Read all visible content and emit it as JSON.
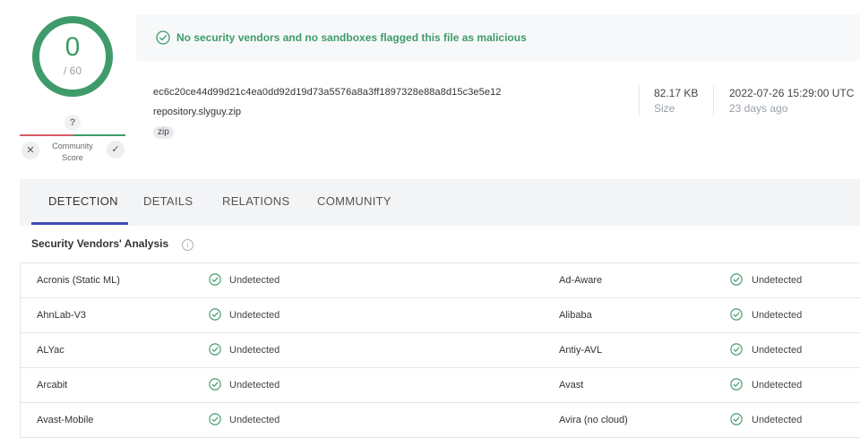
{
  "score": {
    "detected": "0",
    "total": "/ 60"
  },
  "community": {
    "question": "?",
    "label_line1": "Community",
    "label_line2": "Score"
  },
  "banner": {
    "text": "No security vendors and no sandboxes flagged this file as malicious",
    "color": "#3f9b6a"
  },
  "file": {
    "hash": "ec6c20ce44d99d21c4ea0dd92d19d73a5576a8a3ff1897328e88a8d15c3e5e12",
    "name": "repository.slyguy.zip",
    "tag": "zip",
    "size_value": "82.17 KB",
    "size_label": "Size",
    "date_value": "2022-07-26 15:29:00 UTC",
    "date_relative": "23 days ago"
  },
  "tabs": [
    {
      "label": "DETECTION",
      "active": true
    },
    {
      "label": "DETAILS",
      "active": false
    },
    {
      "label": "RELATIONS",
      "active": false
    },
    {
      "label": "COMMUNITY",
      "active": false
    }
  ],
  "section_title": "Security Vendors' Analysis",
  "vendors": [
    {
      "left": "Acronis (Static ML)",
      "left_status": "Undetected",
      "right": "Ad-Aware",
      "right_status": "Undetected"
    },
    {
      "left": "AhnLab-V3",
      "left_status": "Undetected",
      "right": "Alibaba",
      "right_status": "Undetected"
    },
    {
      "left": "ALYac",
      "left_status": "Undetected",
      "right": "Antiy-AVL",
      "right_status": "Undetected"
    },
    {
      "left": "Arcabit",
      "left_status": "Undetected",
      "right": "Avast",
      "right_status": "Undetected"
    },
    {
      "left": "Avast-Mobile",
      "left_status": "Undetected",
      "right": "Avira (no cloud)",
      "right_status": "Undetected"
    }
  ],
  "colors": {
    "accent_green": "#3f9b6a",
    "accent_red": "#d95a64",
    "tab_underline": "#3c4cb8"
  }
}
